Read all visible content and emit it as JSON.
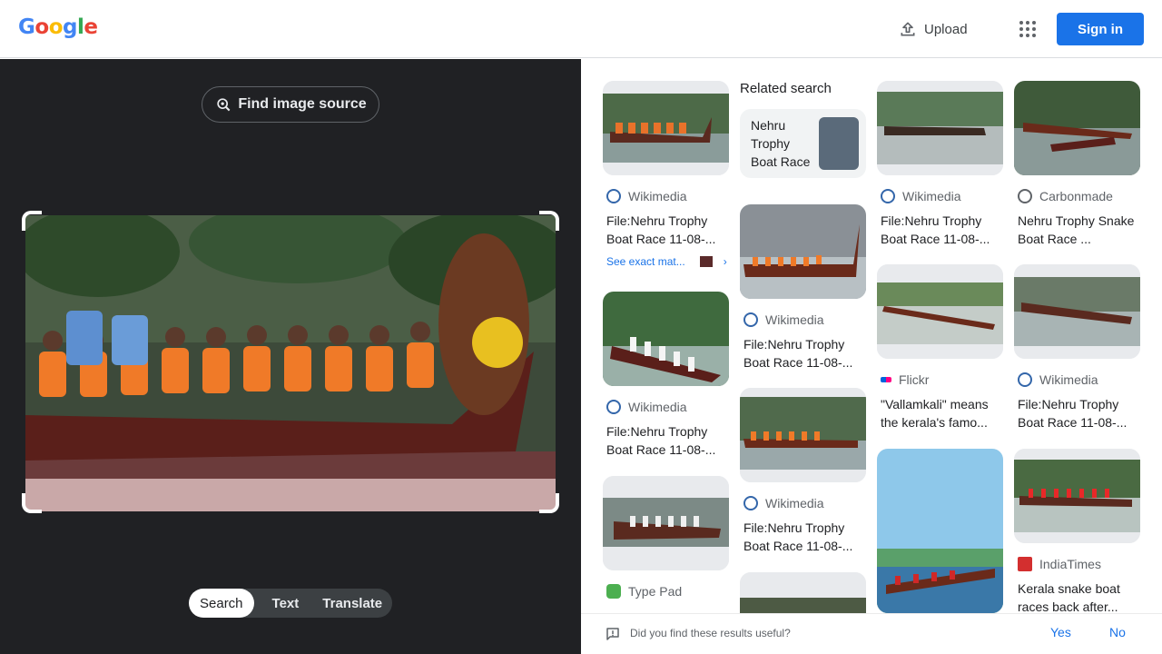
{
  "header": {
    "logo": "Google",
    "upload_label": "Upload",
    "signin_label": "Sign in"
  },
  "left_panel": {
    "find_source_label": "Find image source",
    "tabs": [
      {
        "label": "Search",
        "active": true
      },
      {
        "label": "Text",
        "active": false
      },
      {
        "label": "Translate",
        "active": false
      }
    ]
  },
  "related_search": {
    "heading": "Related search",
    "query": "Nehru Trophy Boat Race"
  },
  "results": [
    {
      "source": "Wikimedia",
      "title": "File:Nehru Trophy Boat Race 11-08-...",
      "see_exact": "See exact mat..."
    },
    {
      "source": "Wikimedia",
      "title": "File:Nehru Trophy Boat Race 11-08-..."
    },
    {
      "source": "Type Pad",
      "title": ""
    },
    {
      "source": "Wikimedia",
      "title": "File:Nehru Trophy Boat Race 11-08-..."
    },
    {
      "source": "Wikimedia",
      "title": "File:Nehru Trophy Boat Race 11-08-..."
    },
    {
      "source": "Wikimedia",
      "title": "File:Nehru Trophy Boat Race 11-08-..."
    },
    {
      "source": "Flickr",
      "title": "\"Vallamkali\" means the kerala's famo..."
    },
    {
      "source": "Carbonmade",
      "title": "Nehru Trophy Snake Boat Race ..."
    },
    {
      "source": "Wikimedia",
      "title": "File:Nehru Trophy Boat Race 11-08-..."
    },
    {
      "source": "IndiaTimes",
      "title": "Kerala snake boat races back after..."
    }
  ],
  "feedback": {
    "question": "Did you find these results useful?",
    "yes": "Yes",
    "no": "No"
  },
  "colors": {
    "accent": "#1a73e8",
    "dark_panel": "#202124"
  }
}
